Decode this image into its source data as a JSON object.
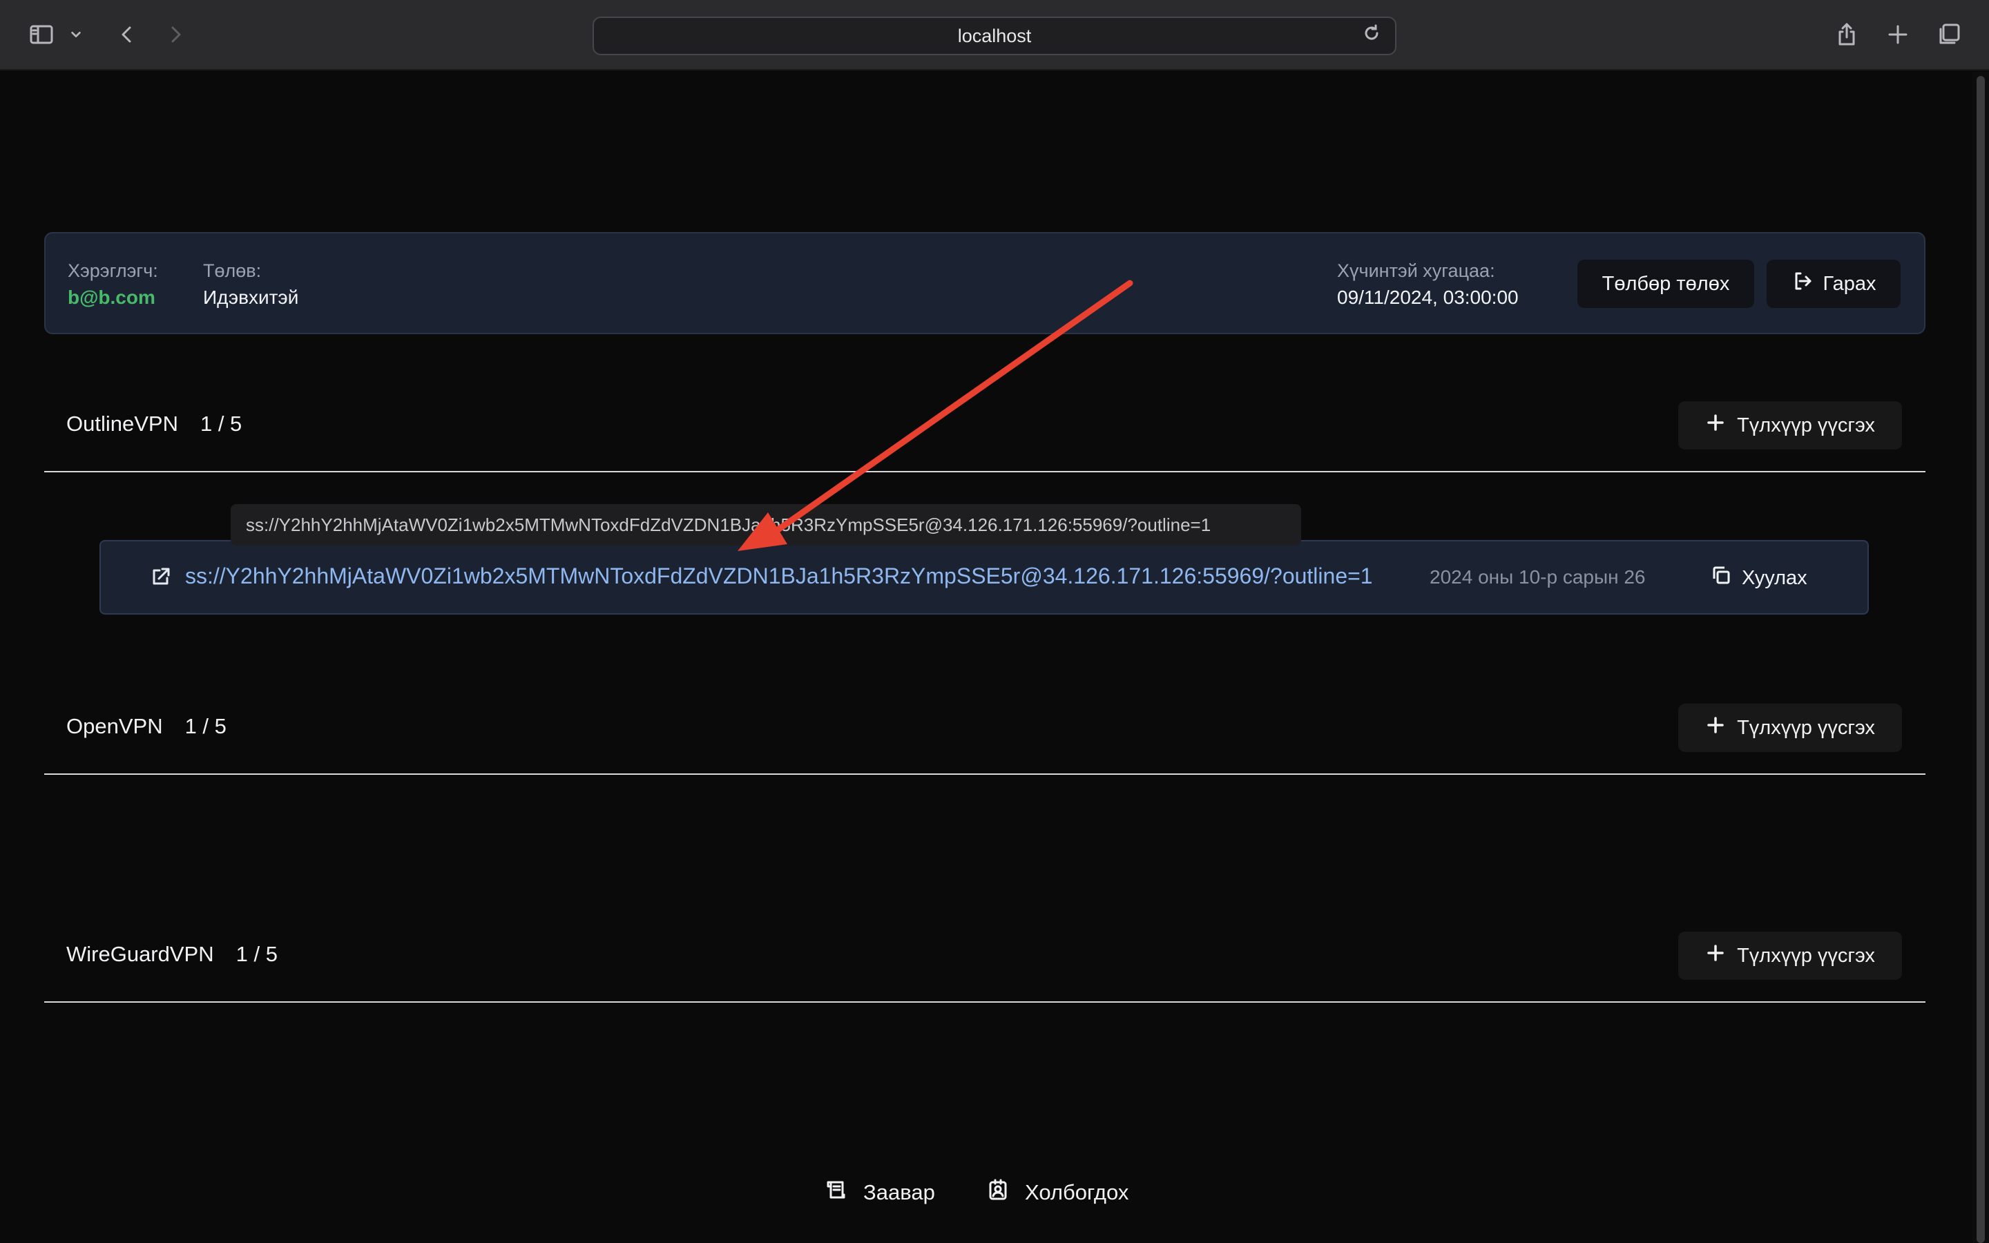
{
  "browser": {
    "address": "localhost"
  },
  "user": {
    "user_label": "Хэрэглэгч:",
    "user_value": "b@b.com",
    "payment_label": "Төлөв:",
    "payment_value": "Идэвхитэй",
    "expiry_label": "Хүчинтэй хугацаа:",
    "expiry_value": "09/11/2024, 03:00:00",
    "pay_button": "Төлбөр төлөх",
    "logout_button": "Гарах"
  },
  "sections": [
    {
      "name": "OutlineVPN",
      "count": "1 / 5",
      "add_button": "Түлхүүр үүсгэх",
      "keys": [
        {
          "url": "ss://Y2hhY2hhMjAtaWV0Zi1wb2x5MTMwNToxdFdZdVZDN1BJa1h5R3RzYmpSSE5r@34.126.171.126:55969/?outline=1",
          "date": "2024 оны 10-р сарын 26",
          "copy_label": "Хуулах"
        }
      ]
    },
    {
      "name": "OpenVPN",
      "count": "1 / 5",
      "add_button": "Түлхүүр үүсгэх"
    },
    {
      "name": "WireGuardVPN",
      "count": "1 / 5",
      "add_button": "Түлхүүр үүсгэх"
    }
  ],
  "tooltip": {
    "text": "ss://Y2hhY2hhMjAtaWV0Zi1wb2x5MTMwNToxdFdZdVZDN1BJa1h5R3RzYmpSSE5r@34.126.171.126:55969/?outline=1"
  },
  "footer": {
    "guide": "Заавар",
    "contact": "Холбогдох"
  },
  "colors": {
    "background": "#0a0a0a",
    "card": "#1b2333",
    "link": "#8fb8f0",
    "user_email": "#48bb6a",
    "annotation_arrow": "#e8412f"
  },
  "icons": {
    "sidebar": "sidebar-icon",
    "back": "chevron-left-icon",
    "forward": "chevron-right-icon",
    "reload": "reload-icon",
    "share": "share-icon",
    "new_tab": "plus-icon",
    "tabs": "tabs-overview-icon",
    "logout": "logout-icon",
    "external": "external-link-icon",
    "copy": "copy-icon",
    "guide": "scroll-icon",
    "contact": "contact-icon"
  }
}
